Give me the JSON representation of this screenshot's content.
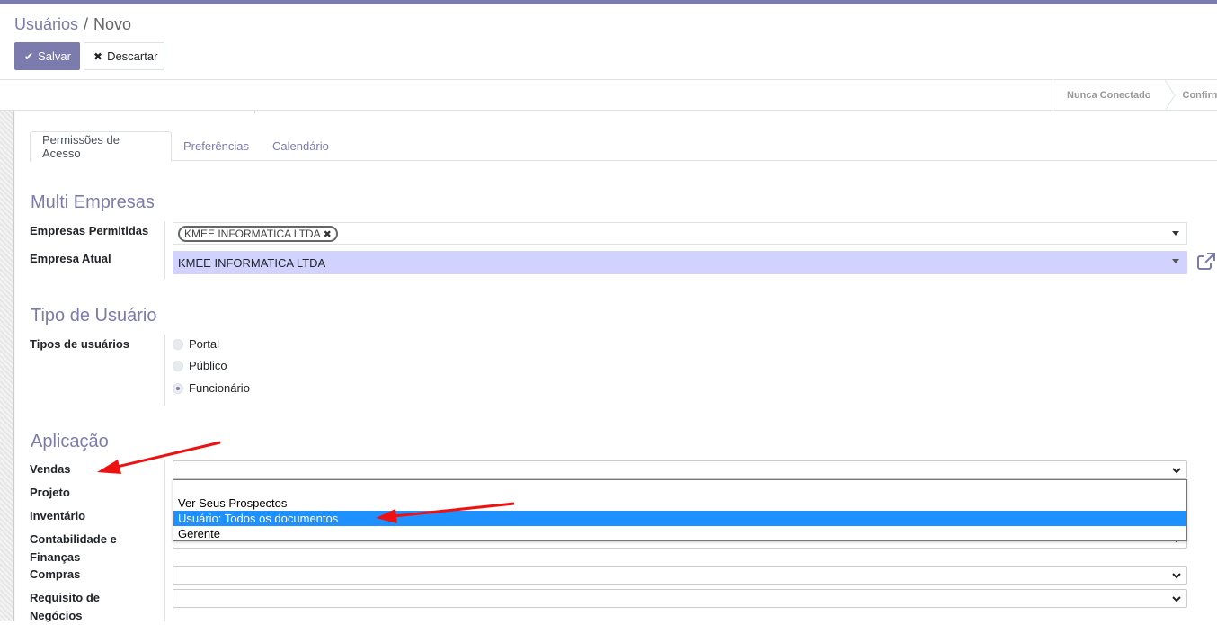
{
  "breadcrumb": {
    "parent": "Usuários",
    "separator": "/",
    "current": "Novo"
  },
  "toolbar": {
    "save_label": "Salvar",
    "discard_label": "Descartar",
    "save_icon": "check-icon",
    "discard_icon": "times-icon"
  },
  "statusbar": {
    "steps": [
      "Nunca Conectado",
      "Confirm"
    ]
  },
  "tabs": [
    {
      "label": "Permissões de Acesso",
      "active": true
    },
    {
      "label": "Preferências",
      "active": false
    },
    {
      "label": "Calendário",
      "active": false
    }
  ],
  "multi_company": {
    "title": "Multi Empresas",
    "allowed_label": "Empresas Permitidas",
    "allowed_tag": "KMEE INFORMATICA LTDA",
    "current_label": "Empresa Atual",
    "current_value": "KMEE INFORMATICA LTDA"
  },
  "user_type": {
    "title": "Tipo de Usuário",
    "label": "Tipos de usuários",
    "options": [
      {
        "label": "Portal",
        "checked": false
      },
      {
        "label": "Público",
        "checked": false
      },
      {
        "label": "Funcionário",
        "checked": true
      }
    ]
  },
  "application": {
    "title": "Aplicação",
    "fields": [
      {
        "label": "Vendas",
        "value": ""
      },
      {
        "label": "Projeto",
        "value": ""
      },
      {
        "label": "Inventário",
        "value": ""
      },
      {
        "label": "Contabilidade e Finanças",
        "value": ""
      },
      {
        "label": "Compras",
        "value": ""
      },
      {
        "label": "Requisito de Negócios",
        "value": ""
      }
    ],
    "dropdown_options": [
      "",
      "Ver Seus Prospectos",
      "Usuário: Todos os documentos",
      "Gerente"
    ],
    "dropdown_highlighted": "Usuário: Todos os documentos"
  },
  "colors": {
    "brand": "#7c7bad",
    "highlight": "#1e90ff",
    "annotation_arrow": "#ee1111",
    "company_field": "#d2d2ff"
  }
}
